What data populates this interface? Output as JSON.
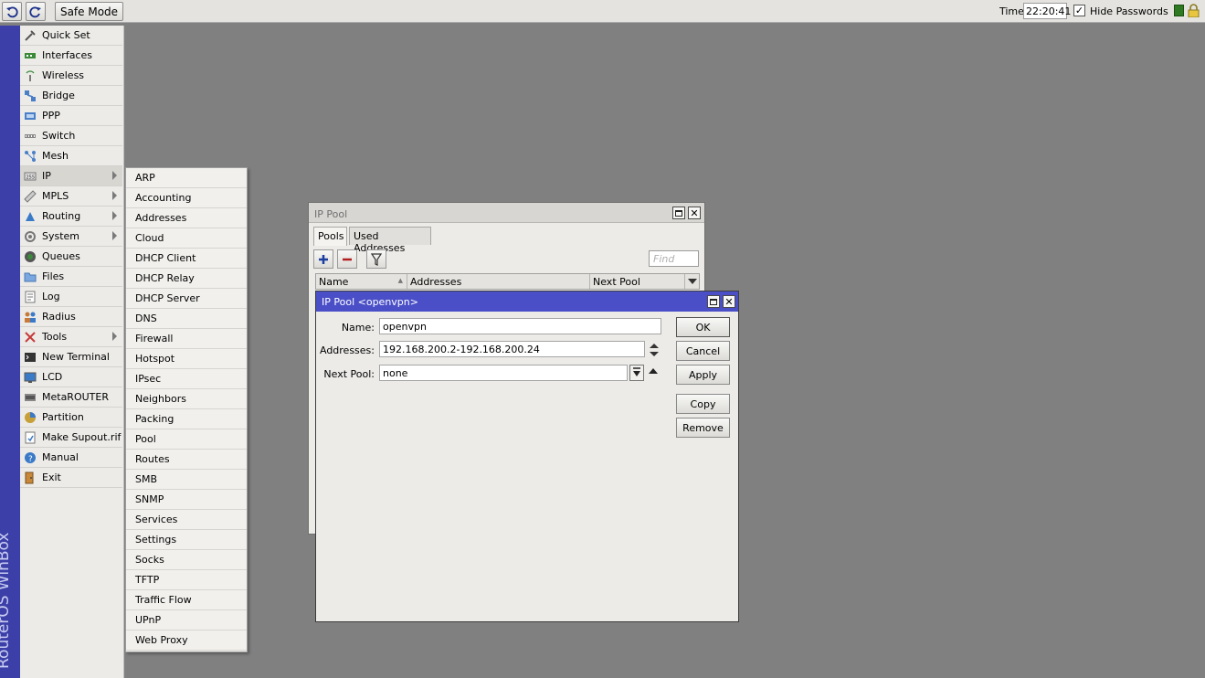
{
  "toolbar": {
    "undo_icon": "undo-icon",
    "redo_icon": "redo-icon",
    "safe_mode_label": "Safe Mode",
    "time_label": "Time",
    "time_value": "22:20:41",
    "hide_passwords_label": "Hide Passwords",
    "hide_passwords_checked": "✓",
    "status_color": "#2d7a22"
  },
  "brand": {
    "text": "RouterOS WinBox",
    "color": "#3b3fa7"
  },
  "menu": {
    "items": [
      {
        "label": "Quick Set",
        "icon": "quick-set-icon"
      },
      {
        "label": "Interfaces",
        "icon": "interfaces-icon"
      },
      {
        "label": "Wireless",
        "icon": "wireless-icon"
      },
      {
        "label": "Bridge",
        "icon": "bridge-icon"
      },
      {
        "label": "PPP",
        "icon": "ppp-icon"
      },
      {
        "label": "Switch",
        "icon": "switch-icon"
      },
      {
        "label": "Mesh",
        "icon": "mesh-icon"
      },
      {
        "label": "IP",
        "icon": "ip-icon"
      },
      {
        "label": "MPLS",
        "icon": "mpls-icon"
      },
      {
        "label": "Routing",
        "icon": "routing-icon"
      },
      {
        "label": "System",
        "icon": "system-icon"
      },
      {
        "label": "Queues",
        "icon": "queues-icon"
      },
      {
        "label": "Files",
        "icon": "files-icon"
      },
      {
        "label": "Log",
        "icon": "log-icon"
      },
      {
        "label": "Radius",
        "icon": "radius-icon"
      },
      {
        "label": "Tools",
        "icon": "tools-icon"
      },
      {
        "label": "New Terminal",
        "icon": "terminal-icon"
      },
      {
        "label": "LCD",
        "icon": "lcd-icon"
      },
      {
        "label": "MetaROUTER",
        "icon": "metarouter-icon"
      },
      {
        "label": "Partition",
        "icon": "partition-icon"
      },
      {
        "label": "Make Supout.rif",
        "icon": "supout-icon"
      },
      {
        "label": "Manual",
        "icon": "manual-icon"
      },
      {
        "label": "Exit",
        "icon": "exit-icon"
      }
    ]
  },
  "submenu": {
    "items": [
      "ARP",
      "Accounting",
      "Addresses",
      "Cloud",
      "DHCP Client",
      "DHCP Relay",
      "DHCP Server",
      "DNS",
      "Firewall",
      "Hotspot",
      "IPsec",
      "Neighbors",
      "Packing",
      "Pool",
      "Routes",
      "SMB",
      "SNMP",
      "Services",
      "Settings",
      "Socks",
      "TFTP",
      "Traffic Flow",
      "UPnP",
      "Web Proxy"
    ]
  },
  "pool_window": {
    "title": "IP Pool",
    "tabs": [
      "Pools",
      "Used Addresses"
    ],
    "find_placeholder": "Find",
    "columns": [
      "Name",
      "Addresses",
      "Next Pool"
    ]
  },
  "edit_window": {
    "title": "IP Pool <openvpn>",
    "name_label": "Name:",
    "name_value": "openvpn",
    "addresses_label": "Addresses:",
    "addresses_value": "192.168.200.2-192.168.200.24",
    "next_pool_label": "Next Pool:",
    "next_pool_value": "none",
    "buttons": {
      "ok": "OK",
      "cancel": "Cancel",
      "apply": "Apply",
      "copy": "Copy",
      "remove": "Remove"
    }
  }
}
